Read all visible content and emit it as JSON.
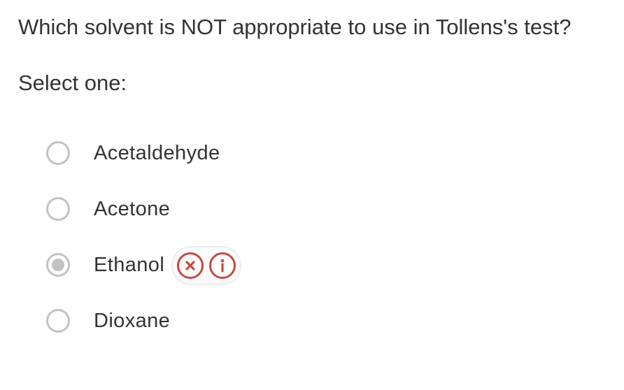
{
  "question": {
    "text": "Which solvent is NOT appropriate to use in Tollens's test?",
    "prompt": "Select one:"
  },
  "options": [
    {
      "label": "Acetaldehyde",
      "selected": false
    },
    {
      "label": "Acetone",
      "selected": false
    },
    {
      "label": "Ethanol",
      "selected": true
    },
    {
      "label": "Dioxane",
      "selected": false
    }
  ],
  "feedback": {
    "incorrect_icon": "times-circle-icon",
    "info_icon": "info-circle-icon",
    "color": "#c44a43"
  },
  "colors": {
    "text": "#333333",
    "radio_border": "#c2c2c2"
  }
}
